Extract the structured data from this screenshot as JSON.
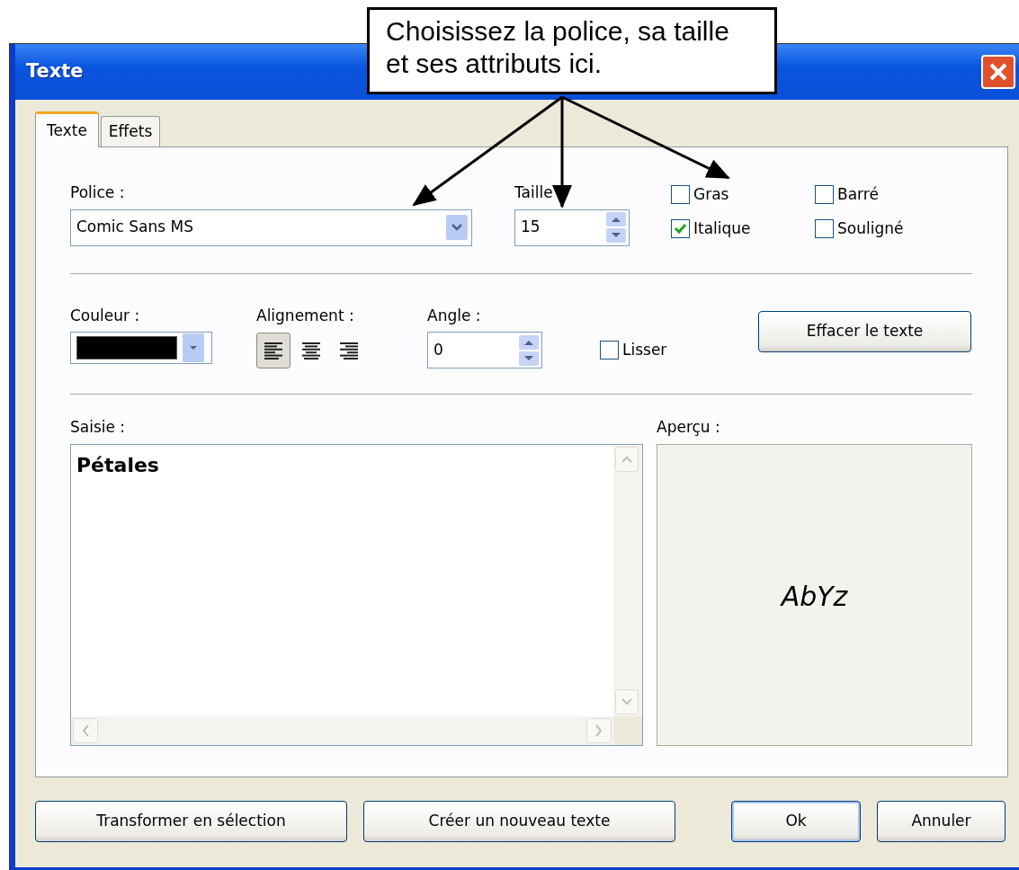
{
  "window": {
    "title": "Texte"
  },
  "tabs": [
    {
      "label": "Texte",
      "selected": true
    },
    {
      "label": "Effets",
      "selected": false
    }
  ],
  "font": {
    "label": "Police :",
    "value": "Comic Sans MS"
  },
  "size": {
    "label": "Taille",
    "value": "15"
  },
  "styles": [
    {
      "label": "Gras",
      "checked": false
    },
    {
      "label": "Barré",
      "checked": false
    },
    {
      "label": "Italique",
      "checked": true
    },
    {
      "label": "Souligné",
      "checked": false
    }
  ],
  "color": {
    "label": "Couleur :",
    "color": "#000000"
  },
  "alignment": {
    "label": "Alignement :",
    "options": [
      {
        "kind": "left",
        "selected": true
      },
      {
        "kind": "center",
        "selected": false
      },
      {
        "kind": "right",
        "selected": false
      }
    ]
  },
  "angle": {
    "label": "Angle :",
    "value": "0"
  },
  "smooth": {
    "label": "Lisser",
    "checked": false
  },
  "clear_button": "Effacer le texte",
  "input": {
    "label": "Saisie :",
    "value": "Pétales"
  },
  "preview": {
    "label": "Aperçu :",
    "sample": "AbYz"
  },
  "buttons": [
    {
      "label": "Transformer en sélection",
      "default": false
    },
    {
      "label": "Créer un nouveau texte",
      "default": false
    },
    {
      "label": "Ok",
      "default": true
    },
    {
      "label": "Annuler",
      "default": false
    }
  ],
  "callout": {
    "text": "Choisissez la police, sa taille et ses attributs ici."
  }
}
